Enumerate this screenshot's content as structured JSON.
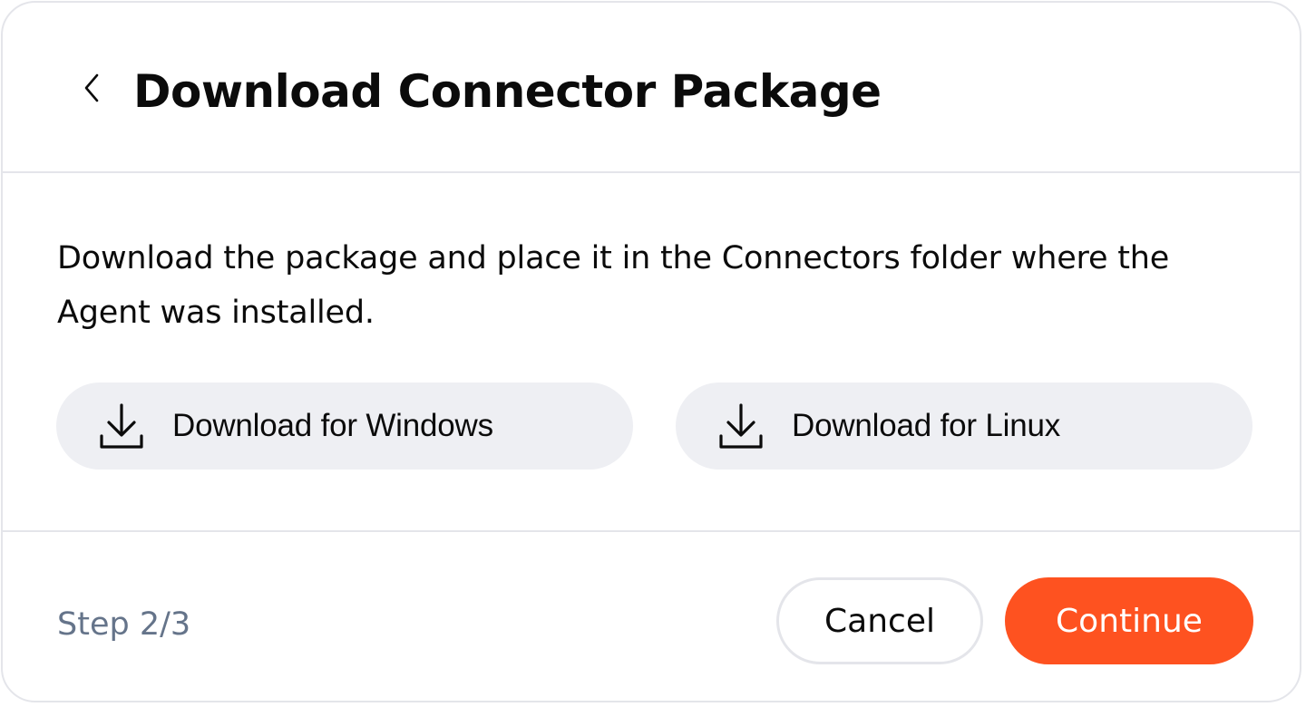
{
  "header": {
    "back_icon": "chevron-left-icon",
    "title": "Download Connector Package"
  },
  "main": {
    "description": "Download the package and place it in the Connectors folder where the Agent was installed.",
    "downloads": [
      {
        "icon": "download-icon",
        "label": "Download for Windows"
      },
      {
        "icon": "download-icon",
        "label": "Download for Linux"
      }
    ]
  },
  "footer": {
    "step": "Step 2/3",
    "cancel_label": "Cancel",
    "continue_label": "Continue"
  },
  "colors": {
    "accent": "#fe5220",
    "border": "#e4e5ea",
    "button_bg": "#eeeff3",
    "muted_text": "#65748a"
  }
}
